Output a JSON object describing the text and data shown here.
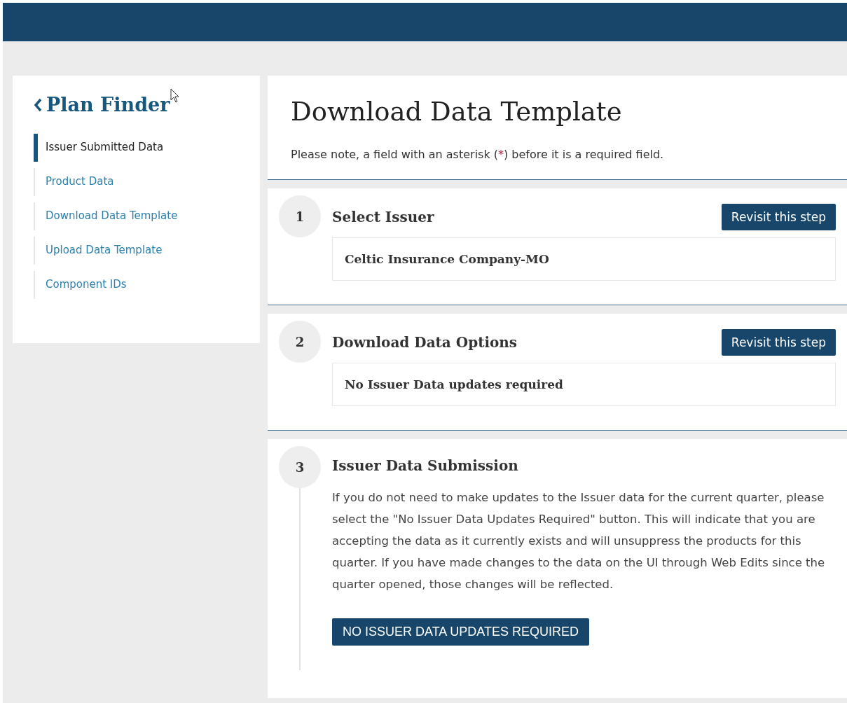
{
  "sidebar": {
    "back_title": "Plan Finder",
    "items": [
      {
        "label": "Issuer Submitted Data",
        "selected": true
      },
      {
        "label": "Product Data",
        "selected": false
      },
      {
        "label": "Download Data Template",
        "selected": false
      },
      {
        "label": "Upload Data Template",
        "selected": false
      },
      {
        "label": "Component IDs",
        "selected": false
      }
    ]
  },
  "page": {
    "title": "Download Data Template",
    "note": {
      "before": "Please note, a field with an asterisk (",
      "mark": "*",
      "after": ") before it is a required field."
    }
  },
  "steps": [
    {
      "number": "1",
      "title": "Select Issuer",
      "kind": "summary",
      "button": "Revisit this step",
      "value": "Celtic Insurance Company-MO"
    },
    {
      "number": "2",
      "title": "Download Data Options",
      "kind": "summary",
      "button": "Revisit this step",
      "value": "No Issuer Data updates required"
    },
    {
      "number": "3",
      "title": "Issuer Data Submission",
      "kind": "action",
      "text": "If you do not need to make updates to the Issuer data for the current quarter, please select the \"No Issuer Data Updates Required\" button. This will indicate that you are accepting the data as it currently exists and will unsuppress the products for this quarter. If you have made changes to the data on the UI through Web Edits since the quarter opened, those changes will be reflected.",
      "action": "NO ISSUER DATA UPDATES REQUIRED"
    }
  ]
}
